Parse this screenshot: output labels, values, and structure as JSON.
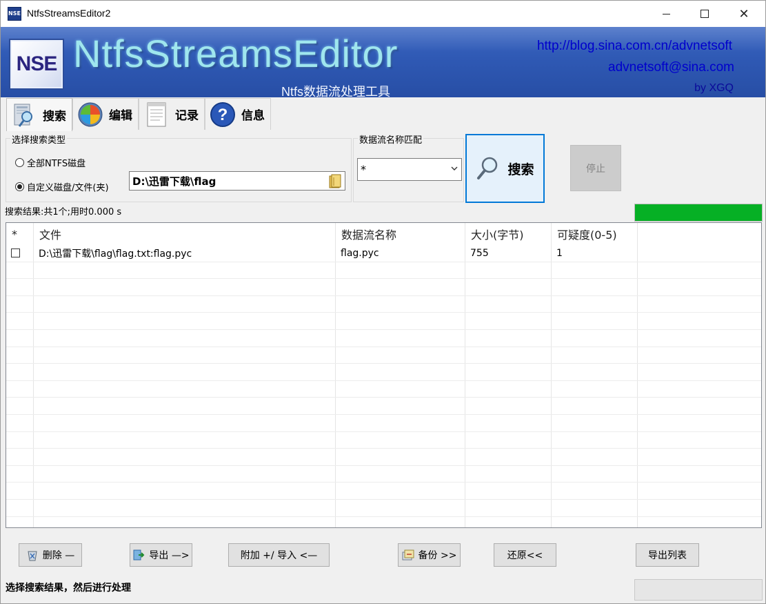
{
  "window": {
    "title": "NtfsStreamsEditor2",
    "icon_text": "NSE"
  },
  "banner": {
    "logo_text": "NSE",
    "brand": "NtfsStreamsEditor",
    "subtitle": "Ntfs数据流处理工具",
    "url": "http://blog.sina.com.cn/advnetsoft",
    "email": "advnetsoft@sina.com",
    "author": "by XGQ"
  },
  "tabs": [
    {
      "label": "搜索",
      "icon": "search-tab-icon"
    },
    {
      "label": "编辑",
      "icon": "edit-tab-icon"
    },
    {
      "label": "记录",
      "icon": "log-tab-icon"
    },
    {
      "label": "信息",
      "icon": "help-tab-icon"
    }
  ],
  "search_type": {
    "title": "选择搜索类型",
    "option_all": "全部NTFS磁盘",
    "option_custom": "自定义磁盘/文件(夹)",
    "path": "D:\\迅雷下载\\flag"
  },
  "stream_match": {
    "title": "数据流名称匹配",
    "value": "*"
  },
  "search_button": "搜索",
  "stop_button": "停止",
  "result_info": "搜索结果:共1个;用时0.000 s",
  "progress": 1.0,
  "table": {
    "headers": [
      "*",
      "文件",
      "数据流名称",
      "大小(字节)",
      "可疑度(0-5)",
      ""
    ],
    "rows": [
      {
        "file": "D:\\迅雷下载\\flag\\flag.txt:flag.pyc",
        "stream": "flag.pyc",
        "size": "755",
        "suspicion": "1"
      }
    ]
  },
  "buttons": {
    "delete": "删除 —",
    "export": "导出 —>",
    "attach_import": "附加 +/ 导入 <—",
    "backup": "备份  >>",
    "restore": "还原<<",
    "export_list": "导出列表"
  },
  "status": "选择搜索结果，然后进行处理",
  "colors": {
    "banner": "#2f59b4",
    "brand_text": "#9fe6ee",
    "link": "#0000cc",
    "progress": "#06b025",
    "search_border": "#0078d7"
  }
}
